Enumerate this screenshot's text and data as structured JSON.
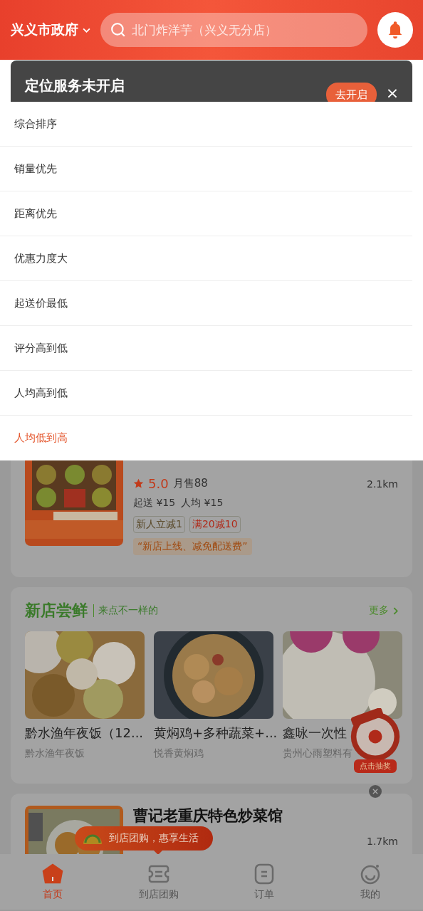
{
  "header": {
    "location": "兴义市政府",
    "search": {
      "placeholder": "北门炸洋芋（兴义无分店）"
    }
  },
  "toast": {
    "title": "定位服务未开启",
    "button": "去开启",
    "close": "×"
  },
  "sort_menu": {
    "items": [
      {
        "label": "综合排序",
        "selected": false
      },
      {
        "label": "销量优先",
        "selected": false
      },
      {
        "label": "距离优先",
        "selected": false
      },
      {
        "label": "优惠力度大",
        "selected": false
      },
      {
        "label": "起送价最低",
        "selected": false
      },
      {
        "label": "评分高到低",
        "selected": false
      },
      {
        "label": "人均高到低",
        "selected": false
      },
      {
        "label": "人均低到高",
        "selected": true
      }
    ]
  },
  "store_card": {
    "rating": "5.0",
    "monthly_sales": "月售88",
    "distance": "2.1km",
    "min_order": "起送 ¥15",
    "avg_price": "人均 ¥15",
    "tags": [
      {
        "text": "新人立减1",
        "kind": "newcomer"
      },
      {
        "text": "满20减10",
        "kind": "discount"
      }
    ],
    "slogan": "“新店上线、减免配送费”"
  },
  "new_stores": {
    "title": "新店尝鲜",
    "subtitle": "来点不一样的",
    "more": "更多",
    "items": [
      {
        "name": "黔水渔年夜饭（12...",
        "shop": "黔水渔年夜饭"
      },
      {
        "name": "黄焖鸡+多种蔬菜+...",
        "shop": "悦香黄焖鸡"
      },
      {
        "name": "鑫咏一次性",
        "shop": "贵州心雨塑料有"
      }
    ]
  },
  "promo_badge": {
    "label": "点击抽奖"
  },
  "store_card_2": {
    "name": "曹记老重庆特色炒菜馆",
    "distance": "1.7km"
  },
  "tooltip": {
    "text": "到店团购，惠享生活"
  },
  "tab_bar": {
    "items": [
      {
        "label": "首页",
        "selected": true,
        "kind": "home"
      },
      {
        "label": "到店团购",
        "selected": false,
        "kind": "groupbuy"
      },
      {
        "label": "订单",
        "selected": false,
        "kind": "orders"
      },
      {
        "label": "我的",
        "selected": false,
        "kind": "profile"
      }
    ]
  }
}
